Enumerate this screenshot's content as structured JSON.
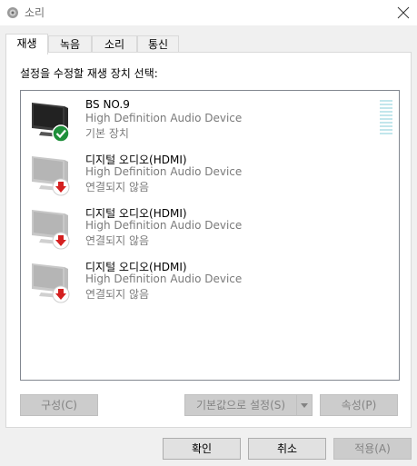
{
  "window": {
    "title": "소리",
    "close_icon": "close-icon",
    "app_icon": "speaker-icon"
  },
  "tabs": [
    {
      "label": "재생",
      "active": true
    },
    {
      "label": "녹음",
      "active": false
    },
    {
      "label": "소리",
      "active": false
    },
    {
      "label": "통신",
      "active": false
    }
  ],
  "instruction": "설정을 수정할 재생 장치 선택:",
  "devices": [
    {
      "name": "BS NO.9",
      "description": "High Definition Audio Device",
      "status": "기본 장치",
      "icon": "monitor-icon",
      "badge": "default-check-icon"
    },
    {
      "name": "디지털 오디오(HDMI)",
      "description": "High Definition Audio Device",
      "status": "연결되지 않음",
      "icon": "monitor-icon",
      "badge": "disconnected-arrow-icon"
    },
    {
      "name": "디지털 오디오(HDMI)",
      "description": "High Definition Audio Device",
      "status": "연결되지 않음",
      "icon": "monitor-icon",
      "badge": "disconnected-arrow-icon"
    },
    {
      "name": "디지털 오디오(HDMI)",
      "description": "High Definition Audio Device",
      "status": "연결되지 않음",
      "icon": "monitor-icon",
      "badge": "disconnected-arrow-icon"
    }
  ],
  "panel_buttons": {
    "configure": "구성(C)",
    "set_default": "기본값으로 설정(S)",
    "properties": "속성(P)"
  },
  "dialog_buttons": {
    "ok": "확인",
    "cancel": "취소",
    "apply": "적용(A)"
  },
  "colors": {
    "default_badge": "#1e8f3a",
    "disconnected_badge": "#d42020",
    "meter": "#c2e6ec"
  }
}
